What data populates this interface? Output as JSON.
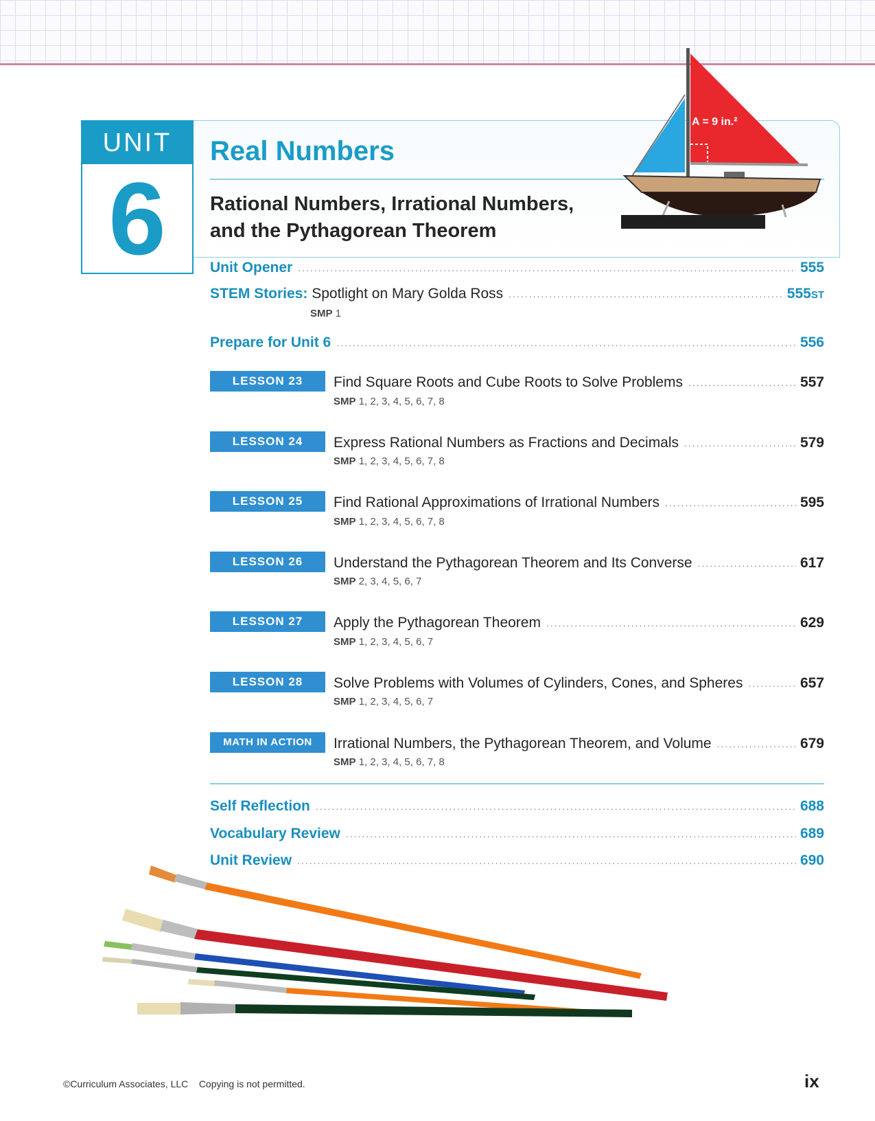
{
  "unit": {
    "label": "UNIT",
    "number": "6",
    "title": "Real Numbers",
    "subtitle_line1": "Rational Numbers, Irrational Numbers,",
    "subtitle_line2": "and the Pythagorean Theorem"
  },
  "illustration": {
    "sail_area_label": "A = 9 in.²",
    "sail_color": "#e8282d",
    "jib_color": "#2aa6e0"
  },
  "toc_top": [
    {
      "label": "Unit Opener",
      "page": "555"
    },
    {
      "label_prefix": "STEM Stories:",
      "label_rest": "Spotlight on Mary Golda Ross",
      "page": "555",
      "page_suffix": "ST",
      "smp_label": "SMP",
      "smp": "1"
    },
    {
      "label": "Prepare for Unit 6",
      "page": "556"
    }
  ],
  "lessons": [
    {
      "tag": "LESSON 23",
      "title": "Find Square Roots and Cube Roots to Solve Problems",
      "page": "557",
      "smp_label": "SMP",
      "smp": "1, 2, 3, 4, 5, 6, 7, 8"
    },
    {
      "tag": "LESSON 24",
      "title": "Express Rational Numbers as Fractions and Decimals",
      "page": "579",
      "smp_label": "SMP",
      "smp": "1, 2, 3, 4, 5, 6, 7, 8"
    },
    {
      "tag": "LESSON 25",
      "title": "Find Rational Approximations of Irrational Numbers",
      "page": "595",
      "smp_label": "SMP",
      "smp": "1, 2, 3, 4, 5, 6, 7, 8"
    },
    {
      "tag": "LESSON 26",
      "title": "Understand the Pythagorean Theorem and Its Converse",
      "page": "617",
      "smp_label": "SMP",
      "smp": "2, 3, 4, 5, 6, 7"
    },
    {
      "tag": "LESSON 27",
      "title": "Apply the Pythagorean Theorem",
      "page": "629",
      "smp_label": "SMP",
      "smp": "1, 2, 3, 4, 5, 6, 7"
    },
    {
      "tag": "LESSON 28",
      "title": "Solve Problems with Volumes of Cylinders, Cones, and Spheres",
      "page": "657",
      "smp_label": "SMP",
      "smp": "1, 2, 3, 4, 5, 6, 7"
    },
    {
      "tag": "MATH IN ACTION",
      "title": "Irrational Numbers, the Pythagorean Theorem, and Volume",
      "page": "679",
      "smp_label": "SMP",
      "smp": "1, 2, 3, 4, 5, 6, 7, 8"
    }
  ],
  "toc_bottom": [
    {
      "label": "Self Reflection",
      "page": "688"
    },
    {
      "label": "Vocabulary Review",
      "page": "689"
    },
    {
      "label": "Unit Review",
      "page": "690"
    }
  ],
  "leader": "........................................................................................................................................................................",
  "footer": {
    "copyright": "©Curriculum Associates, LLC    Copying is not permitted.",
    "page_number": "ix"
  }
}
